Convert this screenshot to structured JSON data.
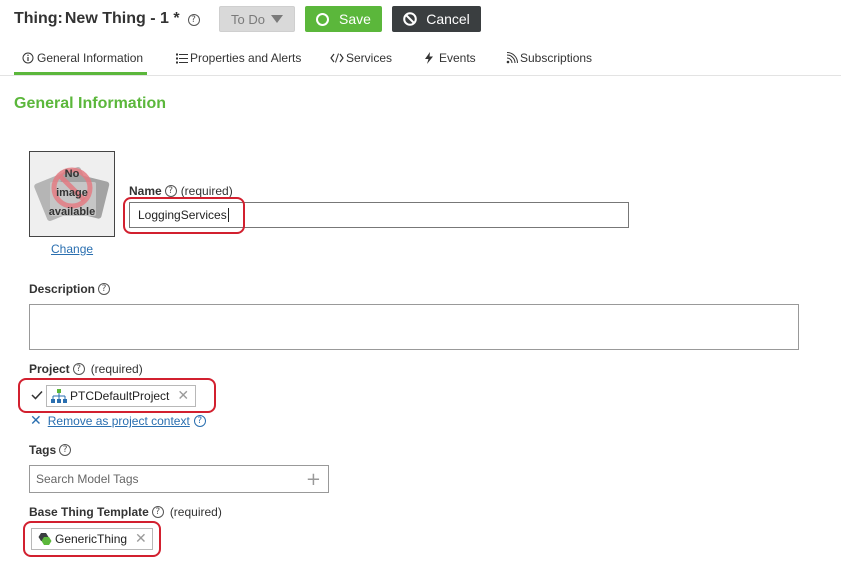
{
  "header": {
    "entity_label": "Thing:",
    "entity_name": "New Thing - 1 *",
    "help": "?",
    "todo_label": "To Do",
    "save_label": "Save",
    "cancel_label": "Cancel"
  },
  "tabs": [
    {
      "label": "General Information",
      "icon": "info-icon",
      "active": true
    },
    {
      "label": "Properties and Alerts",
      "icon": "list-icon",
      "active": false
    },
    {
      "label": "Services",
      "icon": "code-icon",
      "active": false
    },
    {
      "label": "Events",
      "icon": "lightning-icon",
      "active": false
    },
    {
      "label": "Subscriptions",
      "icon": "rss-icon",
      "active": false
    }
  ],
  "section_title": "General Information",
  "image": {
    "placeholder_line1": "No",
    "placeholder_line2": "image",
    "placeholder_line3": "available",
    "change_label": "Change"
  },
  "name": {
    "label": "Name",
    "required": "(required)",
    "value": "LoggingServices"
  },
  "description": {
    "label": "Description",
    "value": ""
  },
  "project": {
    "label": "Project",
    "required": "(required)",
    "value": "PTCDefaultProject",
    "remove_label": "Remove as project context"
  },
  "tags": {
    "label": "Tags",
    "placeholder": "Search Model Tags"
  },
  "base_thing_template": {
    "label": "Base Thing Template",
    "required": "(required)",
    "value": "GenericThing"
  },
  "colors": {
    "accent": "#5bb73b",
    "highlight": "#d2202f",
    "link": "#2a6fb0",
    "cancel": "#3a3e40"
  }
}
